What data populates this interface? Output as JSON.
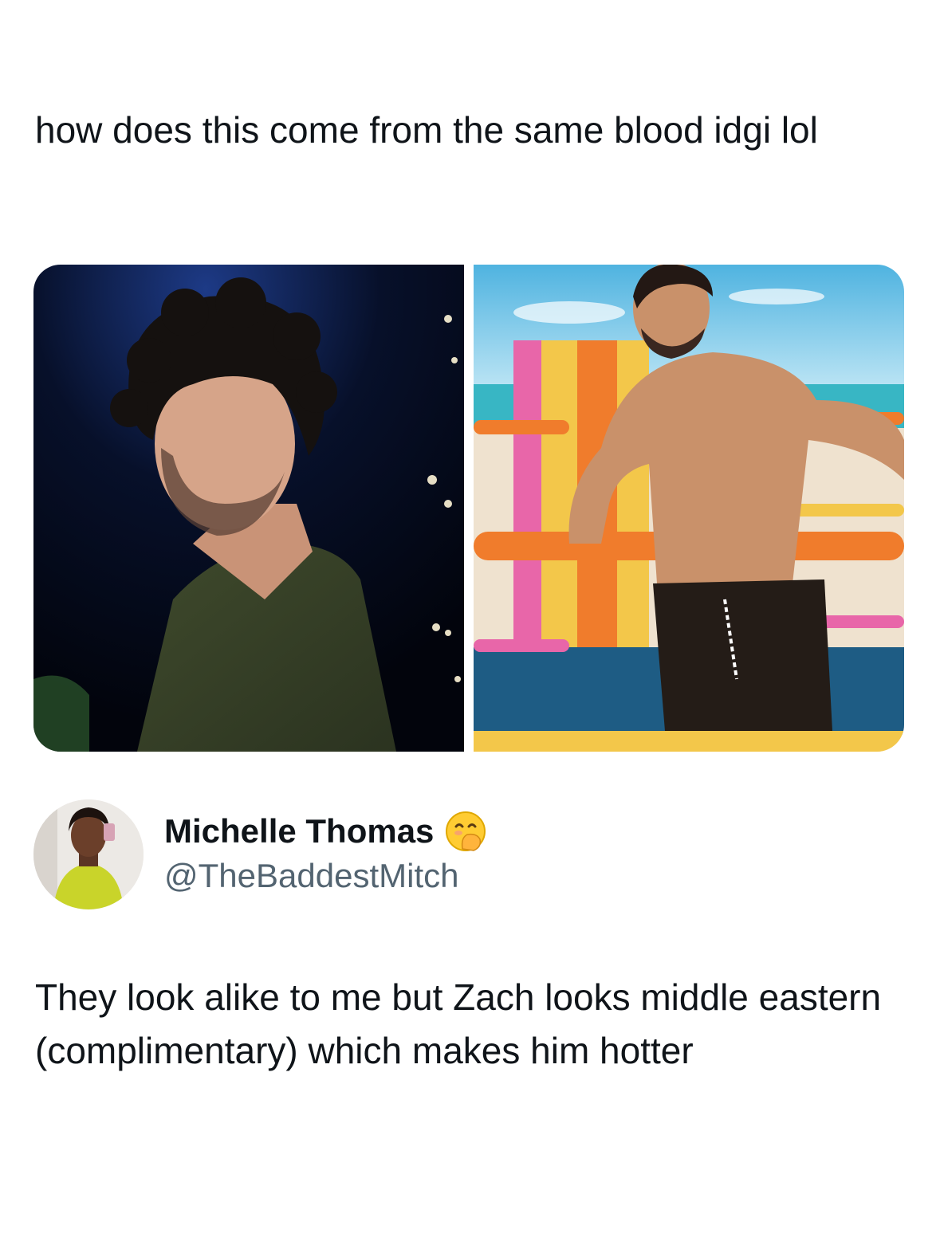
{
  "quoted_tweet": {
    "text": "how does this come from the same blood idgi lol"
  },
  "media": {
    "left_image": "man-curly-hair-green-jacket-photo",
    "right_image": "man-shirtless-beach-lifeguard-stand-photo"
  },
  "author": {
    "display_name": "Michelle Thomas",
    "handle": "@TheBaddestMitch",
    "badge_emoji": "hand-over-mouth-emoji"
  },
  "reply": {
    "text": "They look alike to me but Zach looks middle eastern (complimentary) which makes him hotter"
  },
  "colors": {
    "text_primary": "#0f1419",
    "text_secondary": "#536471",
    "background": "#ffffff"
  }
}
